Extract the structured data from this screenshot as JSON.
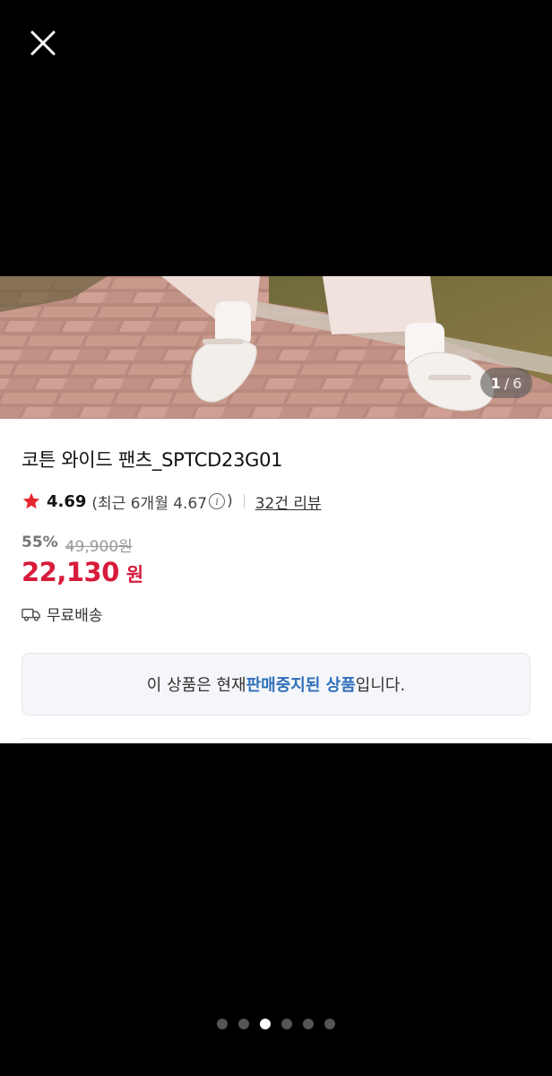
{
  "viewer": {
    "close_icon": "close-icon",
    "counter": {
      "current": "1",
      "separator": "/",
      "total": "6"
    },
    "pager": {
      "count": 6,
      "active_index": 2
    }
  },
  "product": {
    "title": "코튼 와이드 팬츠_SPTCD23G01",
    "rating": "4.69",
    "recent_rating": "(최근 6개월 4.67",
    "recent_close": ")",
    "reviews_label": "32건 리뷰",
    "discount": "55%",
    "original_price": "49,900원",
    "price": "22,130",
    "price_unit": "원",
    "shipping": "무료배송",
    "notice_before": "이 상품은 현재 ",
    "notice_highlight": "판매중지된 상품",
    "notice_after": "입니다."
  },
  "colors": {
    "price": "#d81b3b",
    "star": "#e5262f",
    "highlight": "#2f6fba"
  }
}
